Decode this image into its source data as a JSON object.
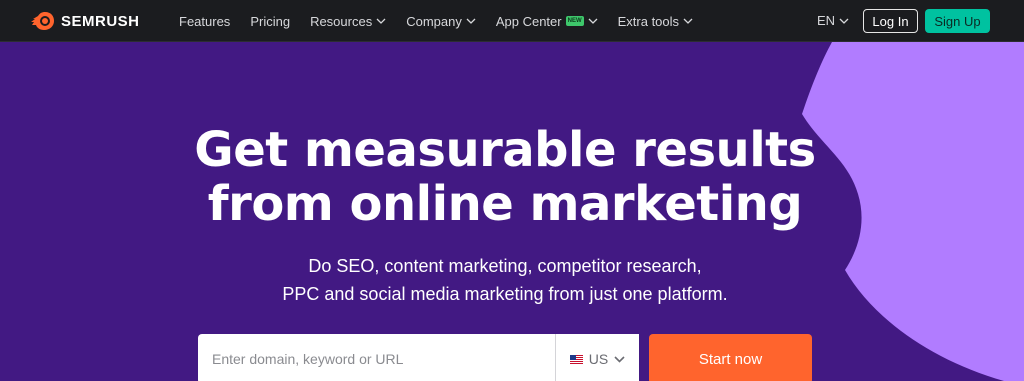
{
  "brand": {
    "name": "SEMRUSH",
    "accent": "#ff642d"
  },
  "nav": {
    "items": [
      {
        "label": "Features",
        "has_dropdown": false
      },
      {
        "label": "Pricing",
        "has_dropdown": false
      },
      {
        "label": "Resources",
        "has_dropdown": true
      },
      {
        "label": "Company",
        "has_dropdown": true
      },
      {
        "label": "App Center",
        "has_dropdown": true,
        "badge": "new"
      },
      {
        "label": "Extra tools",
        "has_dropdown": true
      }
    ],
    "language": "EN",
    "login_label": "Log In",
    "signup_label": "Sign Up"
  },
  "hero": {
    "headline_line1": "Get measurable results",
    "headline_line2": "from online marketing",
    "sub_line1": "Do SEO, content marketing, competitor research,",
    "sub_line2": "PPC and social media marketing from just one platform.",
    "search_placeholder": "Enter domain, keyword or URL",
    "country": "US",
    "start_label": "Start now"
  },
  "colors": {
    "topbar": "#1b1c1f",
    "hero_bg": "#421983",
    "hero_shape": "#b17cff",
    "signup_bg": "#00c2a0",
    "start_bg": "#ff642d"
  }
}
